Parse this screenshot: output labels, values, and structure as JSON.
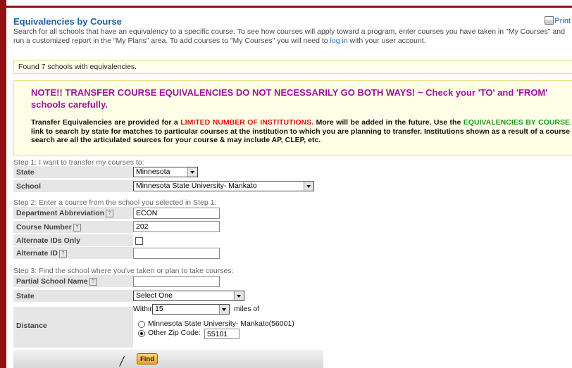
{
  "header": {
    "title": "Equivalencies by Course",
    "print_label": "Print",
    "intro_before_link": "Search for all schools that have an equivalency to a specific course. To see how courses will apply toward a program, enter courses you have taken in \"My Courses\" and run a customized report in the \"My Plans\" area. To add courses to \"My Courses\" you will need to ",
    "intro_link": "log in",
    "intro_after_link": " with your user account."
  },
  "found_message": "Found 7 schools with equivalencies.",
  "note": {
    "heading": "NOTE!! TRANSFER COURSE EQUIVALENCIES DO NOT NECESSARILY GO BOTH WAYS! ~ Check your 'TO' and 'FROM' schools carefully.",
    "body_1": "Transfer Equivalencies are provided for a ",
    "body_red": "LIMITED NUMBER OF INSTITUTIONS.",
    "body_2": " More will be added in the future. Use the ",
    "body_green": "EQUIVALENCIES BY COURSE",
    "body_3": " link to search by state for matches to particular courses at the institution to which you are planning to transfer. Institutions shown as a result of a course search are all the articulated sources for your course & may include AP, CLEP, etc."
  },
  "step1": {
    "heading": "Step 1: I want to transfer my courses to:",
    "state_label": "State",
    "state_value": "Minnesota",
    "school_label": "School",
    "school_value": "Minnesota State University- Mankato"
  },
  "step2": {
    "heading": "Step 2: Enter a course from the school you selected in Step 1:",
    "dept_label": "Department Abbreviation",
    "dept_value": "ECON",
    "course_label": "Course Number",
    "course_value": "202",
    "alt_only_label": "Alternate IDs Only",
    "alt_id_label": "Alternate ID",
    "alt_id_value": ""
  },
  "step3": {
    "heading": "Step 3: Find the school where you've taken or plan to take courses:",
    "partial_label": "Partial School Name",
    "partial_value": "",
    "state_label": "State",
    "state_value": "Select One",
    "distance_label": "Distance",
    "within_label": "Within",
    "within_value": "15",
    "miles_label": "miles of",
    "radio1_label": "Minnesota State University- Mankato(56001)",
    "radio2_label": "Other Zip Code:",
    "zip_value": "55101"
  },
  "find_button": "Find",
  "hint_glyph": "?"
}
